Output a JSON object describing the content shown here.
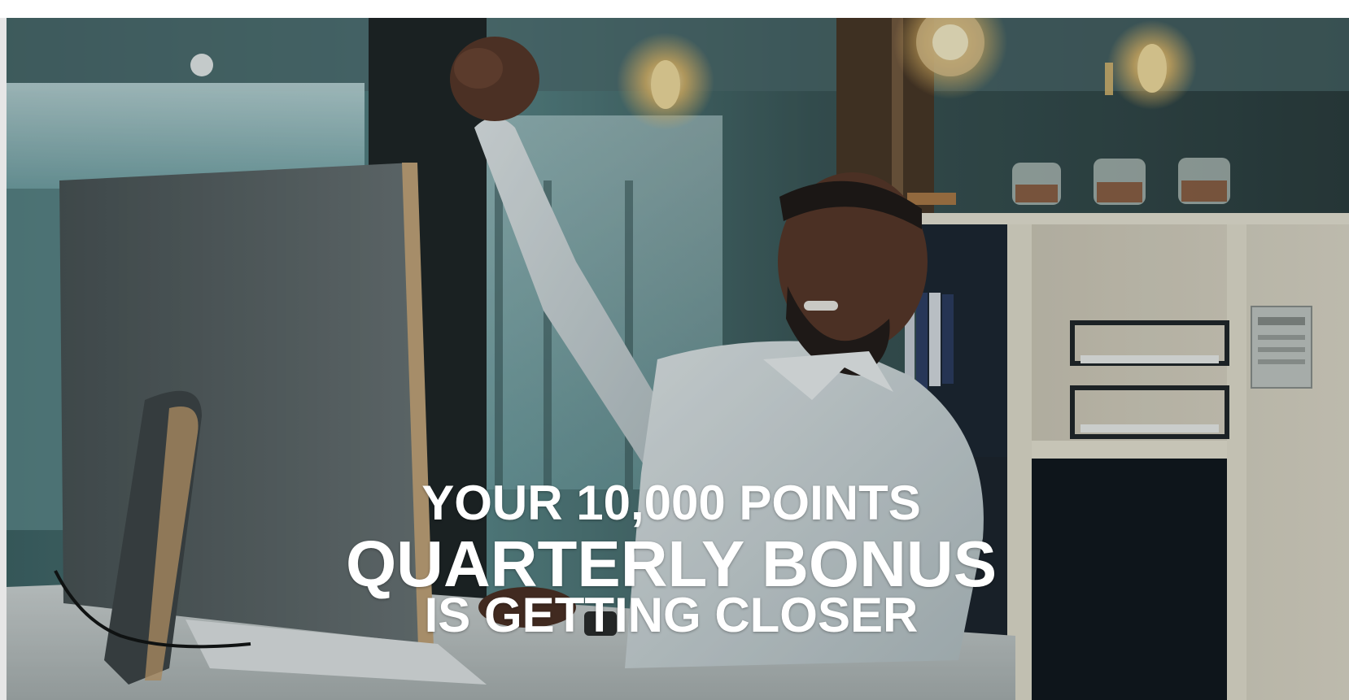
{
  "banner": {
    "headline_line1": "YOUR 10,000 POINTS",
    "headline_line2": "QUARTERLY BONUS",
    "headline_line3": "IS GETTING CLOSER"
  },
  "image": {
    "icon": "celebrating-man-at-desk-photo"
  },
  "colors": {
    "text": "#ffffff",
    "background_teal": "#2c4648",
    "page_background": "#ffffff"
  }
}
